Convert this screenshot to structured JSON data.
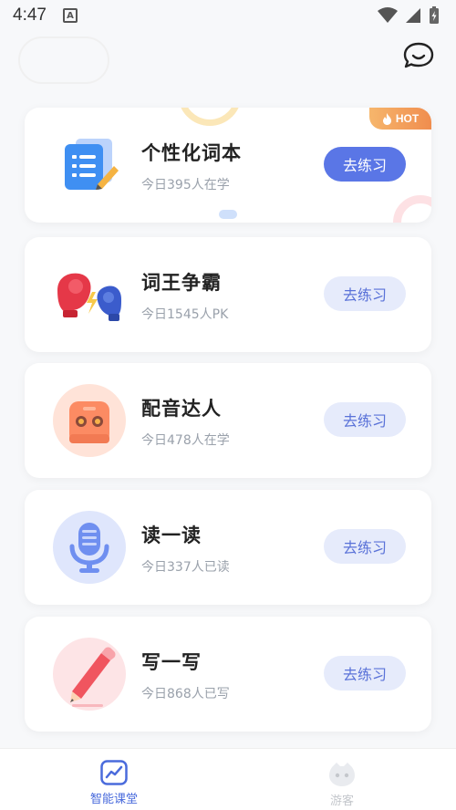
{
  "status_bar": {
    "time": "4:47",
    "notification_glyph": "A"
  },
  "header": {
    "chat_icon": "chat-bubble-icon"
  },
  "cards": [
    {
      "title": "个性化词本",
      "subtitle": "今日395人在学",
      "button": "去练习",
      "badge": "HOT",
      "icon": "notebook-icon"
    },
    {
      "title": "词王争霸",
      "subtitle": "今日1545人PK",
      "button": "去练习",
      "icon": "boxing-gloves-icon"
    },
    {
      "title": "配音达人",
      "subtitle": "今日478人在学",
      "button": "去练习",
      "icon": "robot-icon"
    },
    {
      "title": "读一读",
      "subtitle": "今日337人已读",
      "button": "去练习",
      "icon": "microphone-icon"
    },
    {
      "title": "写一写",
      "subtitle": "今日868人已写",
      "button": "去练习",
      "icon": "pencil-icon"
    }
  ],
  "bottom_nav": [
    {
      "label": "智能课堂",
      "active": true,
      "icon": "chart-line-icon"
    },
    {
      "label": "游客",
      "active": false,
      "icon": "guest-avatar-icon"
    }
  ],
  "colors": {
    "primary": "#5a76e6",
    "button_light": "#e6ebfb",
    "hot": "#f08d4e"
  }
}
